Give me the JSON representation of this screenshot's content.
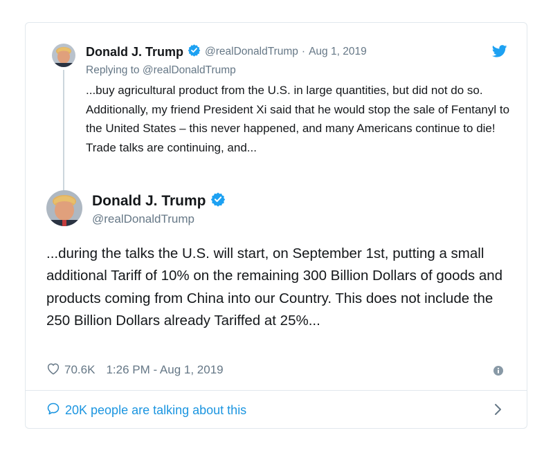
{
  "colors": {
    "link_blue": "#1b95e0",
    "verified_blue": "#1da1f2",
    "muted_gray": "#657786",
    "text_dark": "#14171a",
    "border": "#e1e8ed"
  },
  "icons": {
    "twitter": "twitter-bird-icon",
    "verified": "verified-badge-icon",
    "like": "heart-icon",
    "info": "info-icon",
    "conversation": "speech-bubble-icon",
    "more": "chevron-right-icon"
  },
  "parent_tweet": {
    "name": "Donald J. Trump",
    "handle": "@realDonaldTrump",
    "separator": "·",
    "date": "Aug 1, 2019",
    "replying_prefix": "Replying to",
    "replying_handle": "@realDonaldTrump",
    "text": "...buy agricultural product from the U.S. in large quantities, but did not do so. Additionally, my friend President Xi said that he would stop the sale of Fentanyl to the United States – this never happened, and many Americans continue to die! Trade talks are continuing, and..."
  },
  "main_tweet": {
    "name": "Donald J. Trump",
    "handle": "@realDonaldTrump",
    "text": "...during the talks the U.S. will start, on September 1st, putting a small additional Tariff of 10% on the remaining 300 Billion Dollars of goods and products coming from China into our Country. This does not include the 250 Billion Dollars already Tariffed at 25%...",
    "likes": "70.6K",
    "timestamp": "1:26 PM - Aug 1, 2019"
  },
  "footer": {
    "talking_text": "20K people are talking about this"
  }
}
